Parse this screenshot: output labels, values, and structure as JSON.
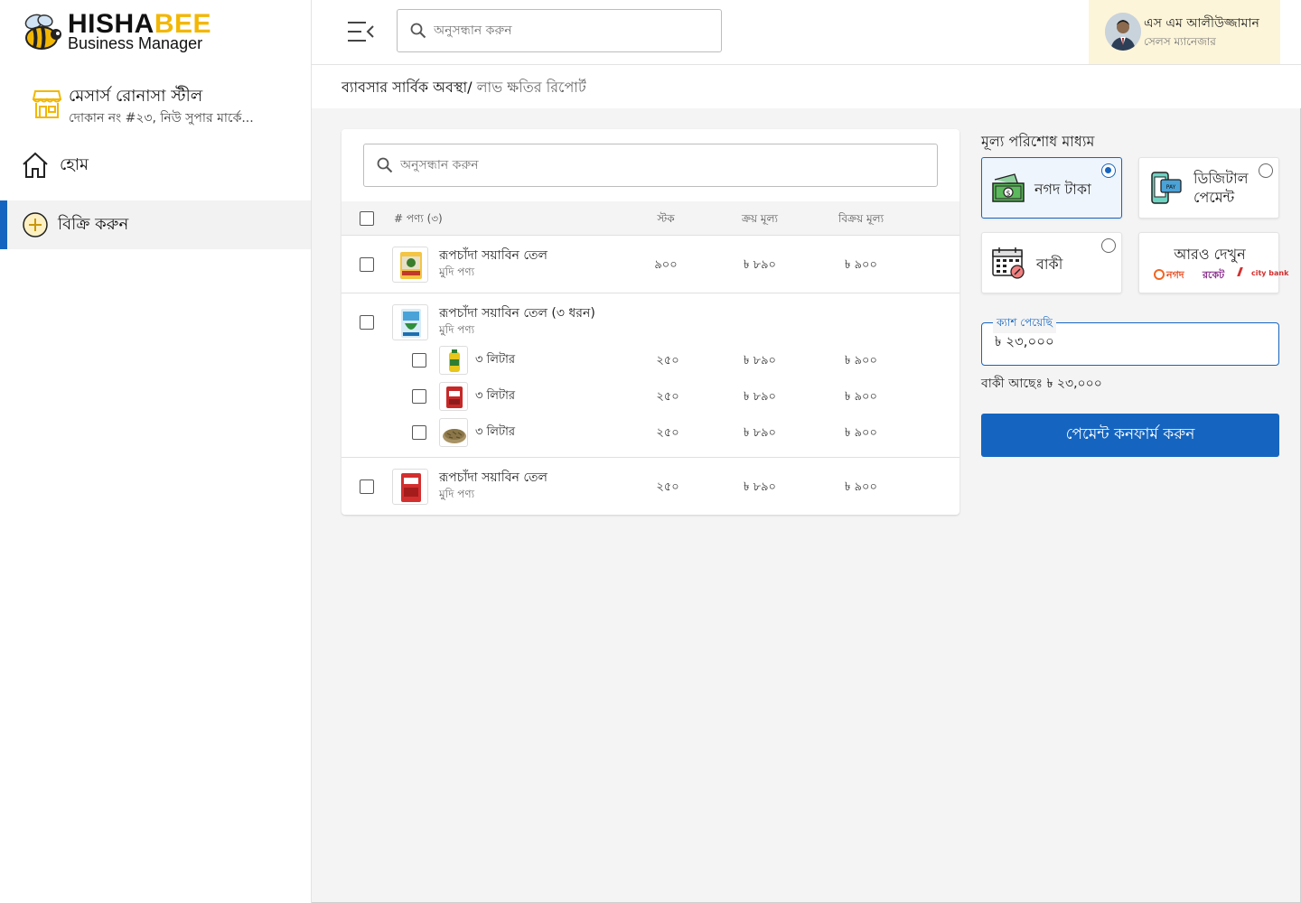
{
  "app": {
    "logo_title_a": "HISHA",
    "logo_title_b": "BEE",
    "logo_subtitle": "Business Manager",
    "brand_color": "#f2b705",
    "accent_color": "#1565c0"
  },
  "shop": {
    "name": "মেসার্স রোনাসা স্টীল",
    "address": "দোকান নং #২৩, নিউ সুপার মার্কে..."
  },
  "sidebar": {
    "items": [
      {
        "label": "হোম",
        "icon": "home-icon",
        "active": false
      },
      {
        "label": "বিক্রি করুন",
        "icon": "plus-circle-icon",
        "active": true
      }
    ]
  },
  "header": {
    "search_placeholder": "অনুসন্ধান করুন",
    "user_name": "এস এম আলীউজ্জামান",
    "user_role": "সেলস ম্যানেজার"
  },
  "breadcrumb": {
    "part1": "ব্যাবসার সার্বিক অবস্থা/",
    "part2": " লাভ ক্ষতির রিপোর্ট"
  },
  "products": {
    "search_placeholder": "অনুসন্ধান করুন",
    "columns": {
      "product": "# পণ্য  (৩)",
      "stock": "স্টক",
      "buy_price": "ক্রয় মূল্য",
      "sell_price": "বিক্রয় মূল্য"
    },
    "rows": [
      {
        "name": "রূপচাঁদা সয়াবিন তেল",
        "category": "মুদি পণ্য",
        "stock": "৯০০",
        "buy": "৳ ৮৯০",
        "sell": "৳ ৯০০"
      },
      {
        "name": "রূপচাঁদা সয়াবিন তেল (৩ ধরন)",
        "category": "মুদি পণ্য",
        "variants": [
          {
            "name": "৩ লিটার",
            "stock": "২৫০",
            "buy": "৳ ৮৯০",
            "sell": "৳ ৯০০"
          },
          {
            "name": "৩ লিটার",
            "stock": "২৫০",
            "buy": "৳ ৮৯০",
            "sell": "৳ ৯০০"
          },
          {
            "name": "৩ লিটার",
            "stock": "২৫০",
            "buy": "৳ ৮৯০",
            "sell": "৳ ৯০০"
          }
        ]
      },
      {
        "name": "রূপচাঁদা সয়াবিন তেল",
        "category": "মুদি পণ্য",
        "stock": "২৫০",
        "buy": "৳ ৮৯০",
        "sell": "৳ ৯০০"
      }
    ]
  },
  "payment": {
    "title": "মূল্য পরিশোধ মাধ্যম",
    "options": {
      "cash": {
        "line1": "নগদ টাকা",
        "selected": true
      },
      "digital": {
        "line1": "ডিজিটাল",
        "line2": "পেমেন্ট",
        "selected": false
      },
      "due": {
        "line1": "বাকী",
        "selected": false
      },
      "more": {
        "label": "আরও দেখুন",
        "brands": [
          "নগদ",
          "রকেট",
          "city bank"
        ]
      }
    },
    "cash_label": "ক্যাশ পেয়েছি",
    "cash_value": "৳ ২৩,০০০",
    "due_text": "বাকী আছেঃ ৳ ২৩,০০০",
    "confirm_label": "পেমেন্ট কনফার্ম করুন"
  }
}
